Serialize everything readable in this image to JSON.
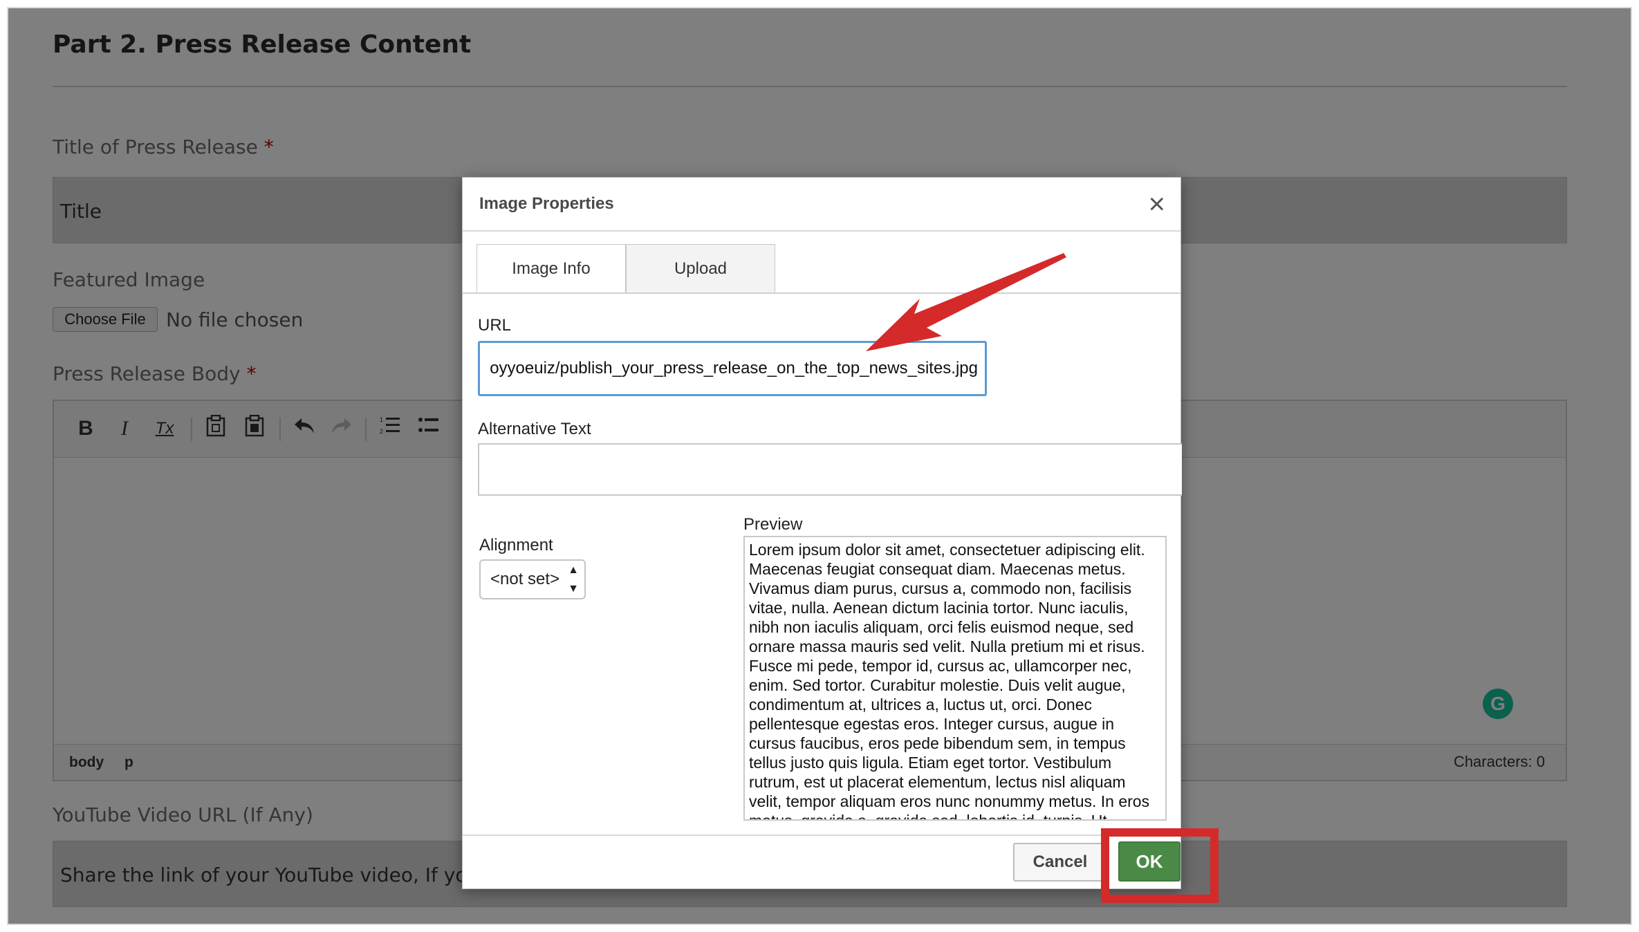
{
  "page": {
    "section_title": "Part 2. Press Release Content",
    "title_label": "Title of Press Release",
    "title_value": "Title",
    "featured_image_label": "Featured Image",
    "choose_file_label": "Choose File",
    "no_file_text": "No file chosen",
    "body_label": "Press Release Body",
    "required_mark": "*",
    "status_path": [
      "body",
      "p"
    ],
    "char_count": "Characters: 0",
    "youtube_label": "YouTube Video URL (If Any)",
    "youtube_placeholder": "Share the link of your YouTube video, If you h",
    "toolbar": {
      "bold": "B",
      "italic": "I",
      "remove_format": "Tx"
    }
  },
  "dialog": {
    "title": "Image Properties",
    "close": "×",
    "tabs": [
      {
        "label": "Image Info",
        "active": true
      },
      {
        "label": "Upload",
        "active": false
      }
    ],
    "url_label": "URL",
    "url_value": "oyyoeuiz/publish_your_press_release_on_the_top_news_sites.jpg",
    "alt_label": "Alternative Text",
    "alt_value": "",
    "alignment_label": "Alignment",
    "alignment_value": "<not set>",
    "preview_label": "Preview",
    "preview_text": "Lorem ipsum dolor sit amet, consectetuer adipiscing elit. Maecenas feugiat consequat diam. Maecenas metus. Vivamus diam purus, cursus a, commodo non, facilisis vitae, nulla. Aenean dictum lacinia tortor. Nunc iaculis, nibh non iaculis aliquam, orci felis euismod neque, sed ornare massa mauris sed velit. Nulla pretium mi et risus. Fusce mi pede, tempor id, cursus ac, ullamcorper nec, enim. Sed tortor. Curabitur molestie. Duis velit augue, condimentum at, ultrices a, luctus ut, orci. Donec pellentesque egestas eros. Integer cursus, augue in cursus faucibus, eros pede bibendum sem, in tempus tellus justo quis ligula. Etiam eget tortor. Vestibulum rutrum, est ut placerat elementum, lectus nisl aliquam velit, tempor aliquam eros nunc nonummy metus. In eros metus, gravida a, gravida sed, lobortis id, turpis. Ut",
    "cancel_label": "Cancel",
    "ok_label": "OK"
  },
  "colors": {
    "ok_button": "#4a8a46",
    "highlight": "#d42a2a",
    "url_focus": "#5b9bd5"
  }
}
